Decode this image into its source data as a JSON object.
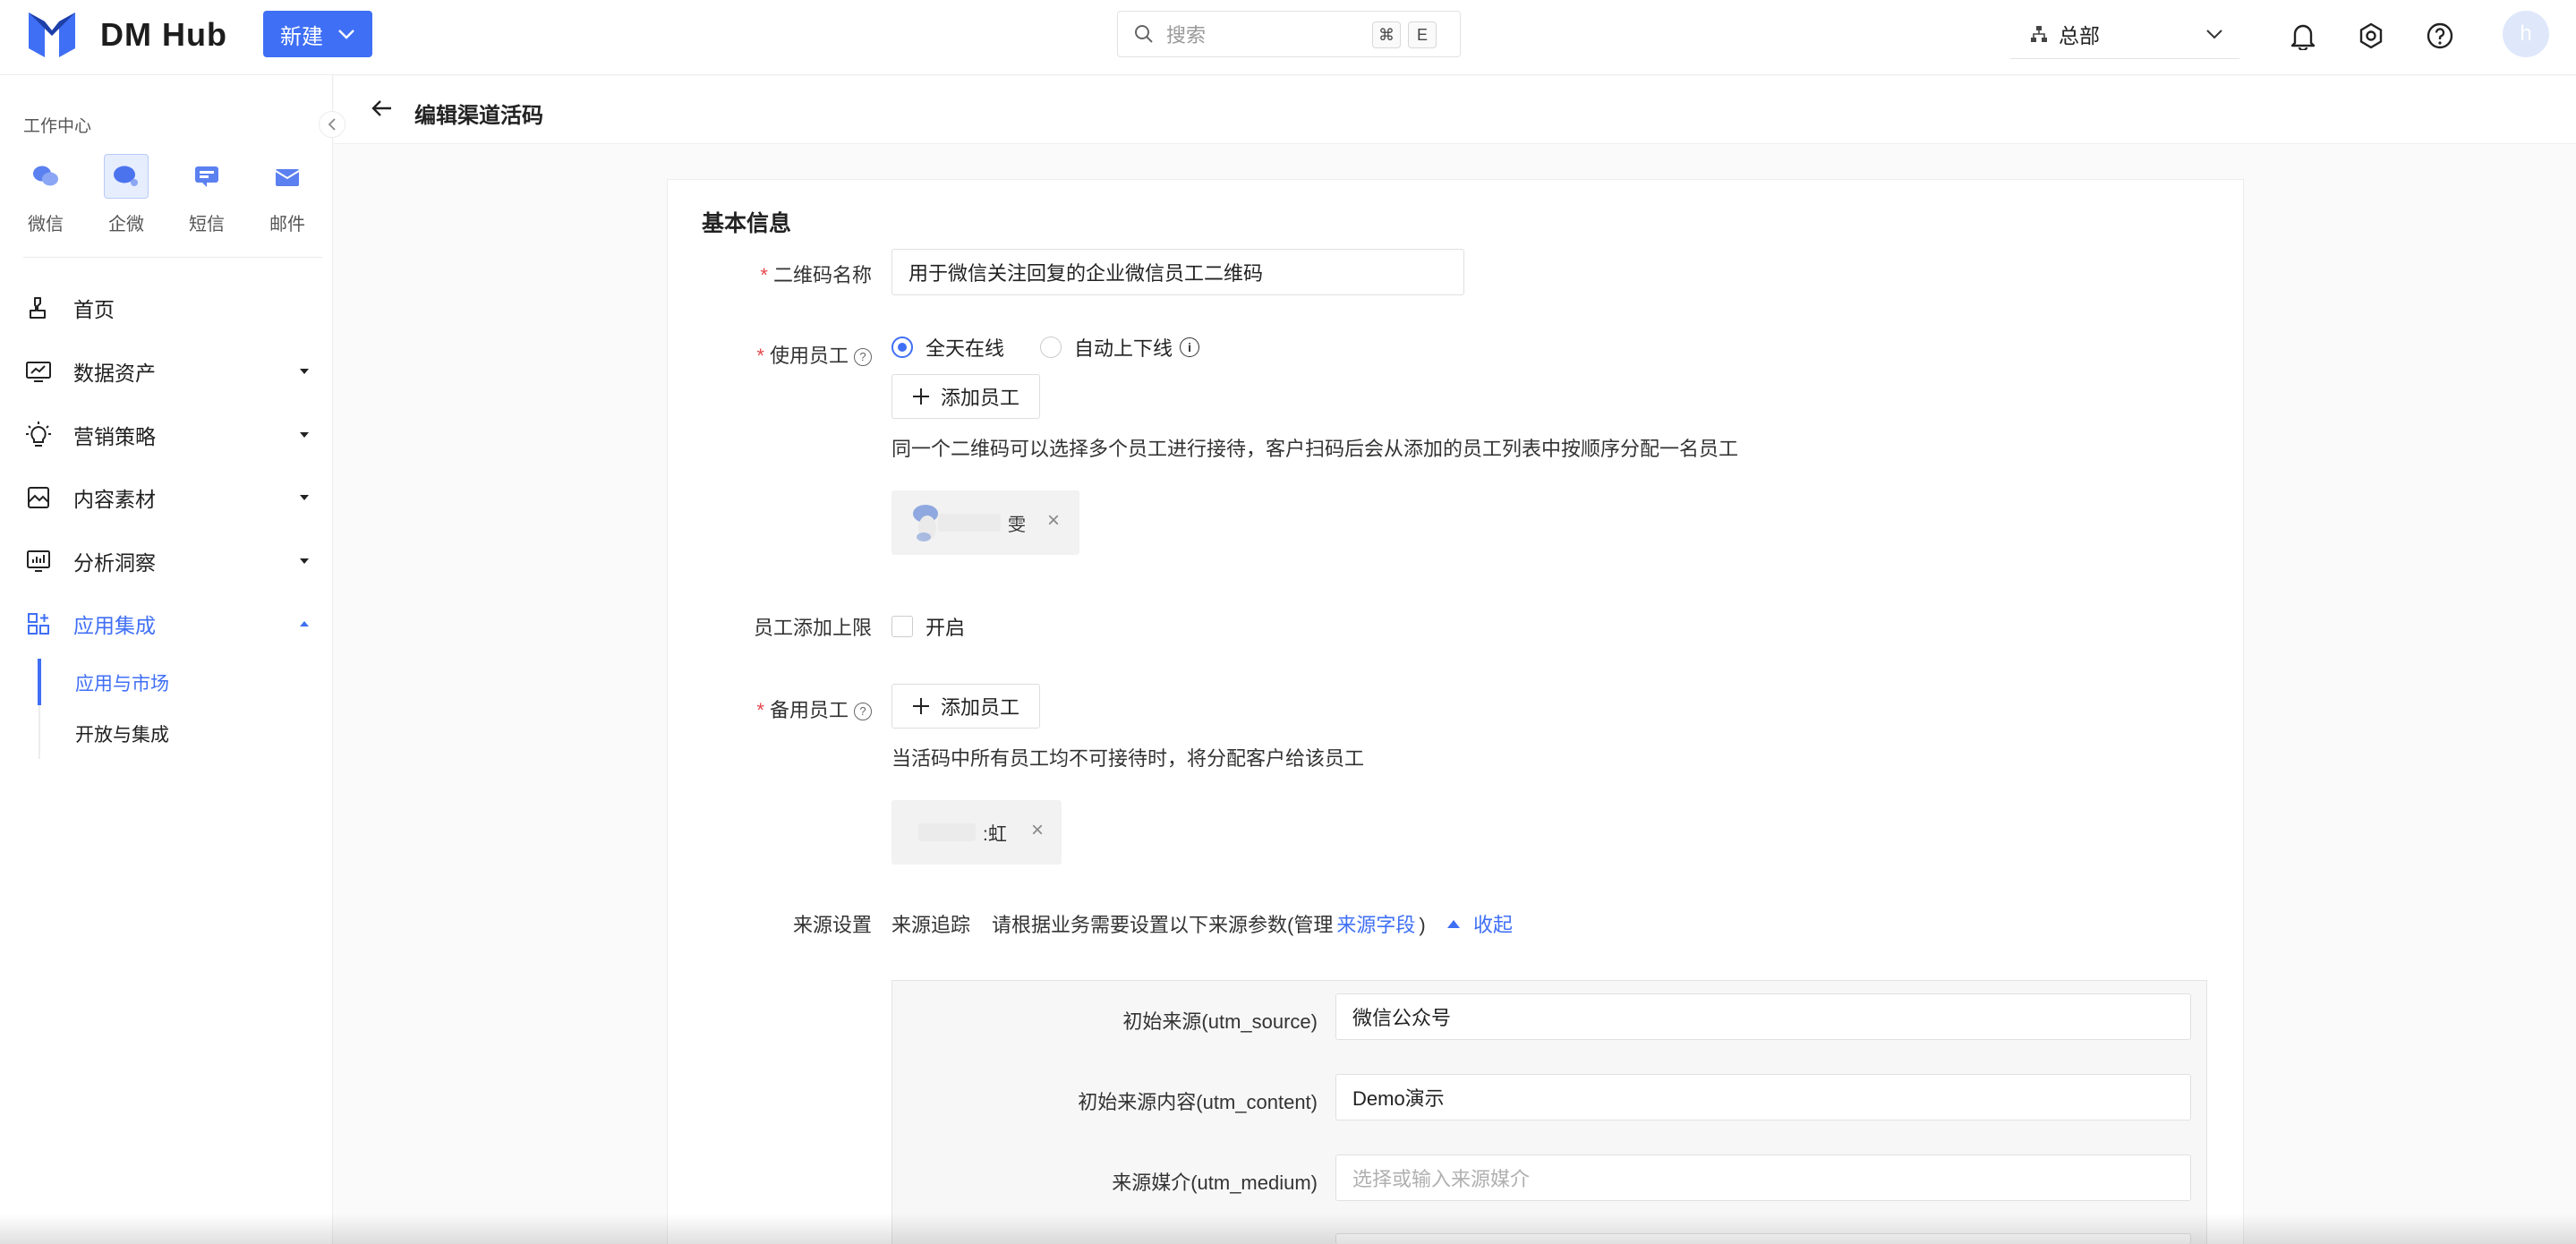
{
  "app": {
    "brand": "DM Hub",
    "new_button": "新建",
    "search_placeholder": "搜索",
    "shortcut_keys": [
      "⌘",
      "E"
    ],
    "org": "总部",
    "avatar_initial": "h"
  },
  "sidebar": {
    "workcenter_title": "工作中心",
    "channels": [
      {
        "label": "微信",
        "icon": "wechat-icon",
        "active": false
      },
      {
        "label": "企微",
        "icon": "wecom-icon",
        "active": true
      },
      {
        "label": "短信",
        "icon": "sms-icon",
        "active": false
      },
      {
        "label": "邮件",
        "icon": "mail-icon",
        "active": false
      }
    ],
    "nav": [
      {
        "label": "首页",
        "icon": "home-icon"
      },
      {
        "label": "数据资产",
        "icon": "data-asset-icon"
      },
      {
        "label": "营销策略",
        "icon": "bulb-icon"
      },
      {
        "label": "内容素材",
        "icon": "content-icon"
      },
      {
        "label": "分析洞察",
        "icon": "analysis-icon"
      },
      {
        "label": "应用集成",
        "icon": "apps-icon",
        "active": true
      }
    ],
    "subnav": [
      {
        "label": "应用与市场",
        "active": true
      },
      {
        "label": "开放与集成",
        "active": false
      }
    ]
  },
  "page": {
    "title": "编辑渠道活码"
  },
  "form": {
    "section_title": "基本信息",
    "qr_name_label": "二维码名称",
    "qr_name_value": "用于微信关注回复的企业微信员工二维码",
    "staff_label": "使用员工",
    "radio_all_day": "全天在线",
    "radio_auto": "自动上下线",
    "add_staff": "添加员工",
    "staff_hint": "同一个二维码可以选择多个员工进行接待，客户扫码后会从添加的员工列表中按顺序分配一名员工",
    "staff_chip_suffix": "雯",
    "limit_label": "员工添加上限",
    "limit_toggle": "开启",
    "backup_label": "备用员工",
    "backup_hint": "当活码中所有员工均不可接待时，将分配客户给该员工",
    "backup_chip_suffix": ":虹",
    "source_label": "来源设置",
    "source_tracking": "来源追踪",
    "source_desc": "请根据业务需要设置以下来源参数(管理",
    "source_link": "来源字段",
    "source_close_paren": ")",
    "collapse": "收起",
    "utm": [
      {
        "label": "初始来源(utm_source)",
        "value": "微信公众号",
        "placeholder": ""
      },
      {
        "label": "初始来源内容(utm_content)",
        "value": "Demo演示",
        "placeholder": ""
      },
      {
        "label": "来源媒介(utm_medium)",
        "value": "",
        "placeholder": "选择或输入来源媒介"
      }
    ]
  },
  "colors": {
    "accent": "#3f6ff5",
    "required": "#e5484d"
  }
}
